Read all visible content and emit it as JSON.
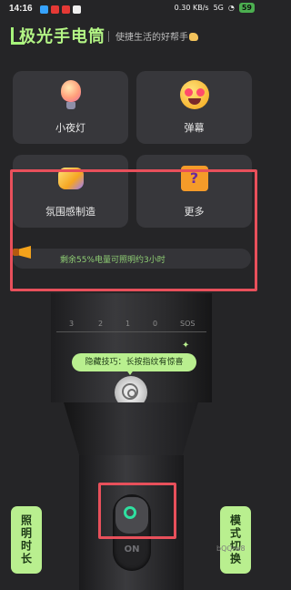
{
  "status_bar": {
    "time": "14:16",
    "network_speed": "0.30 KB/s",
    "signal": "5G",
    "battery": "59"
  },
  "header": {
    "title": "极光手电筒",
    "slogan": "使捷生活的好帮手"
  },
  "features": [
    {
      "label": "小夜灯",
      "icon": "lightbulb-icon"
    },
    {
      "label": "弹幕",
      "icon": "heart-eyes-emoji-icon"
    },
    {
      "label": "氛围感制造",
      "icon": "thread-spool-icon"
    },
    {
      "label": "更多",
      "icon": "mystery-box-icon"
    }
  ],
  "battery_notice": "剩余55%电量可照明约3小时",
  "dial_labels": [
    "3",
    "2",
    "1",
    "0",
    "SOS"
  ],
  "tip": "隐藏技巧：长按指纹有惊喜",
  "switch_label": "ON",
  "side_buttons": {
    "left": "照明时长",
    "right": "模式切换"
  },
  "watermark": "bQQlw8",
  "colors": {
    "accent_green": "#b9ef8f",
    "highlight_red": "#e8505b",
    "power_teal": "#2fe0a0"
  }
}
